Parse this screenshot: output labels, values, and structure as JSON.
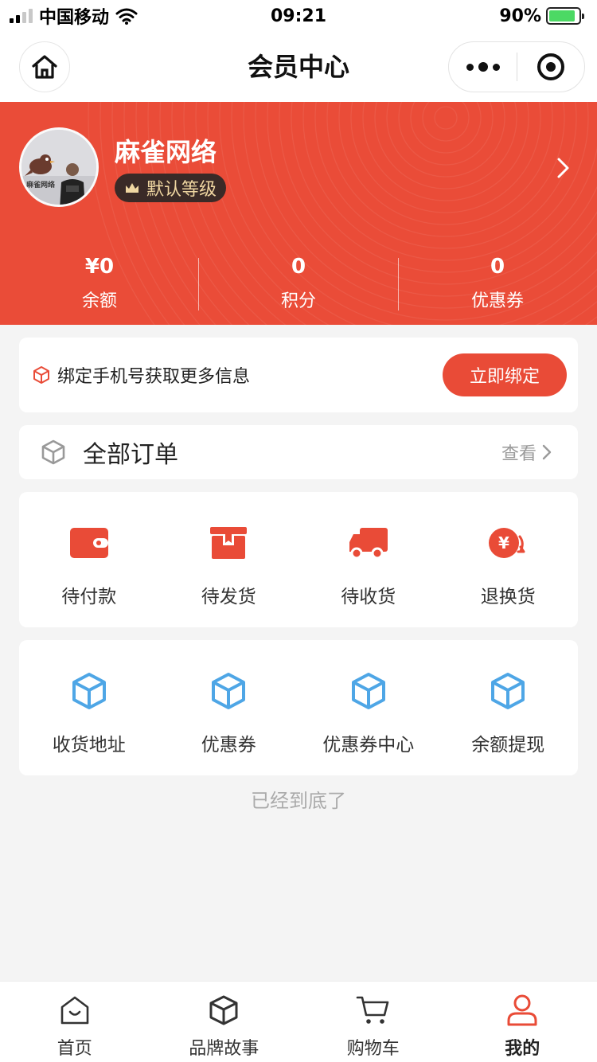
{
  "status_bar": {
    "carrier": "中国移动",
    "time": "09:21",
    "battery": "90%",
    "battery_level": 0.9
  },
  "nav": {
    "title": "会员中心"
  },
  "profile": {
    "name": "麻雀网络",
    "level": "默认等级",
    "avatar_text": "麻雀网络"
  },
  "stats": [
    {
      "value": "¥0",
      "label": "余额"
    },
    {
      "value": "0",
      "label": "积分"
    },
    {
      "value": "0",
      "label": "优惠券"
    }
  ],
  "bind": {
    "text": "绑定手机号获取更多信息",
    "button": "立即绑定"
  },
  "orders": {
    "title": "全部订单",
    "view": "查看"
  },
  "order_status": [
    {
      "label": "待付款",
      "icon": "wallet-icon"
    },
    {
      "label": "待发货",
      "icon": "box-icon"
    },
    {
      "label": "待收货",
      "icon": "truck-icon"
    },
    {
      "label": "退换货",
      "icon": "refund-icon"
    }
  ],
  "services": [
    {
      "label": "收货地址",
      "icon": "cube-icon"
    },
    {
      "label": "优惠券",
      "icon": "cube-icon"
    },
    {
      "label": "优惠券中心",
      "icon": "cube-icon"
    },
    {
      "label": "余额提现",
      "icon": "cube-icon"
    }
  ],
  "footer_text": "已经到底了",
  "tabs": [
    {
      "label": "首页",
      "icon": "home-icon"
    },
    {
      "label": "品牌故事",
      "icon": "cube-icon"
    },
    {
      "label": "购物车",
      "icon": "cart-icon"
    },
    {
      "label": "我的",
      "icon": "user-icon",
      "active": true
    }
  ],
  "colors": {
    "primary": "#EA4C38",
    "accent_blue": "#4EA6E6",
    "badge_bg": "#3A2A27",
    "badge_text": "#F0D7A2"
  }
}
